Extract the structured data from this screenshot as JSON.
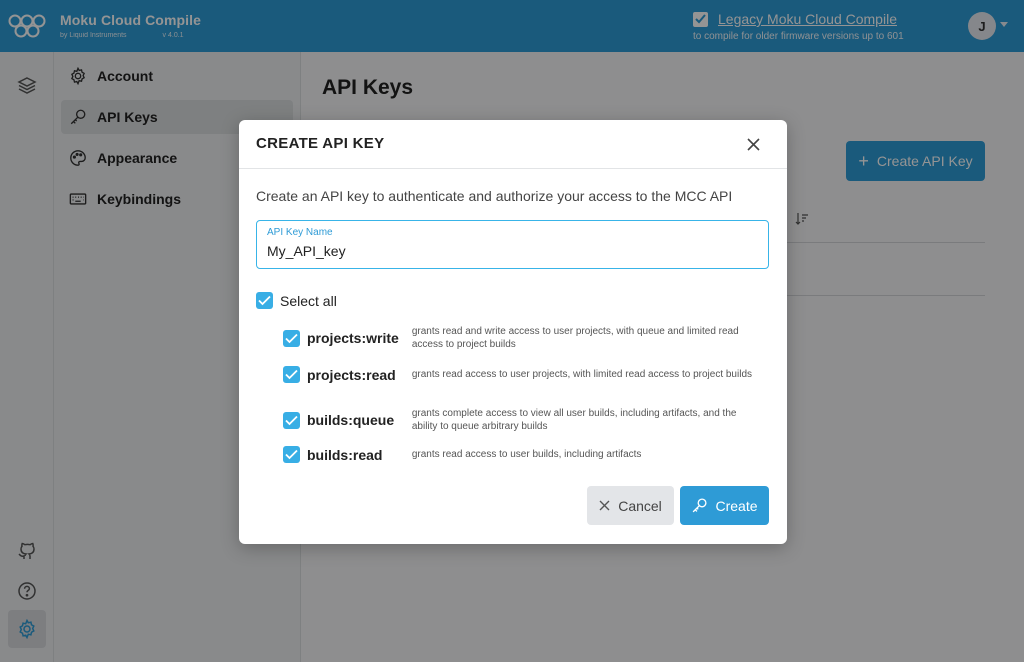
{
  "header": {
    "brand_title": "Moku Cloud Compile",
    "brand_byline": "by Liquid Instruments",
    "version": "v 4.0.1",
    "legacy_link": "Legacy Moku Cloud Compile",
    "legacy_sub": "to compile for older firmware versions up to 601",
    "legacy_checked": true,
    "avatar_initial": "J"
  },
  "rail": {
    "icons": [
      "layers-icon",
      "github-icon",
      "help-icon",
      "settings-icon"
    ],
    "active": "settings-icon"
  },
  "settings_nav": {
    "items": [
      {
        "label": "Account",
        "icon": "gear-icon"
      },
      {
        "label": "API Keys",
        "icon": "key-icon",
        "active": true
      },
      {
        "label": "Appearance",
        "icon": "palette-icon"
      },
      {
        "label": "Keybindings",
        "icon": "keyboard-icon"
      }
    ]
  },
  "main": {
    "title": "API Keys",
    "create_button": "Create API Key"
  },
  "modal": {
    "title": "CREATE API KEY",
    "description": "Create an API key to authenticate and authorize your access to the MCC API",
    "field_label": "API Key Name",
    "field_value": "My_API_key",
    "select_all_label": "Select all",
    "scopes": [
      {
        "name": "projects:write",
        "desc": "grants read and write access to user projects, with queue and limited read access to project builds",
        "checked": true
      },
      {
        "name": "projects:read",
        "desc": "grants read access to user projects, with limited read access to project builds",
        "checked": true
      },
      {
        "name": "builds:queue",
        "desc": "grants complete access to view all user builds, including artifacts, and the ability to queue arbitrary builds",
        "checked": true
      },
      {
        "name": "builds:read",
        "desc": "grants read access to user builds, including artifacts",
        "checked": true
      }
    ],
    "cancel_label": "Cancel",
    "create_label": "Create"
  },
  "colors": {
    "brand": "#2e9bd6",
    "checkbox": "#38aee5",
    "field_border": "#38b4e8"
  }
}
